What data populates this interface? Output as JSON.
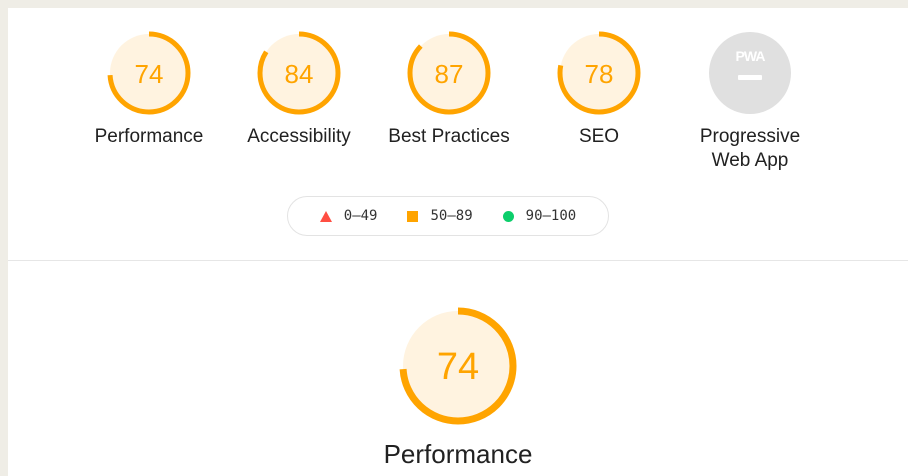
{
  "categories": [
    {
      "id": "performance",
      "label": "Performance",
      "score": "74"
    },
    {
      "id": "accessibility",
      "label": "Accessibility",
      "score": "84"
    },
    {
      "id": "best-practices",
      "label": "Best Practices",
      "score": "87"
    },
    {
      "id": "seo",
      "label": "SEO",
      "score": "78"
    }
  ],
  "pwa": {
    "badge": "PWA",
    "label": "Progressive\nWeb App"
  },
  "legend": {
    "fail": "0–49",
    "average": "50–89",
    "pass": "90–100"
  },
  "main": {
    "score": "74",
    "label": "Performance"
  },
  "colors": {
    "average": "#ffa400",
    "average_fill": "#fff3e0",
    "fail": "#ff4e42",
    "pass": "#0cce6b",
    "pwa_grey": "#e0e0e0"
  }
}
